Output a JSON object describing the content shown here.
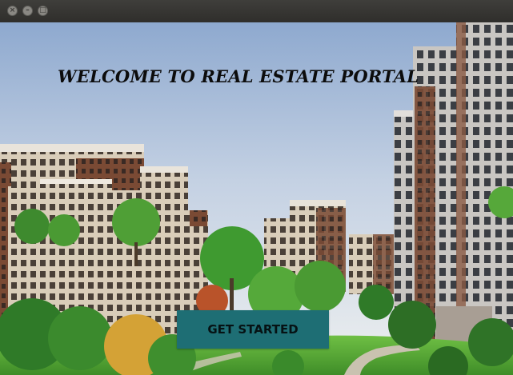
{
  "window": {
    "controls": [
      {
        "name": "close-window-icon",
        "glyph": "×"
      },
      {
        "name": "minimize-window-icon",
        "glyph": "–"
      },
      {
        "name": "maximize-window-icon",
        "glyph": "□"
      }
    ]
  },
  "hero": {
    "headline": "WELCOME TO REAL ESTATE PORTAL"
  },
  "cta": {
    "label": "GET STARTED"
  },
  "colors": {
    "titlebar": "#353431",
    "button_bg": "#1e6e74",
    "button_text": "#061214",
    "sky_top": "#8ea9cf",
    "sky_bottom": "#e9ecef",
    "grass": "#5fae3a"
  }
}
